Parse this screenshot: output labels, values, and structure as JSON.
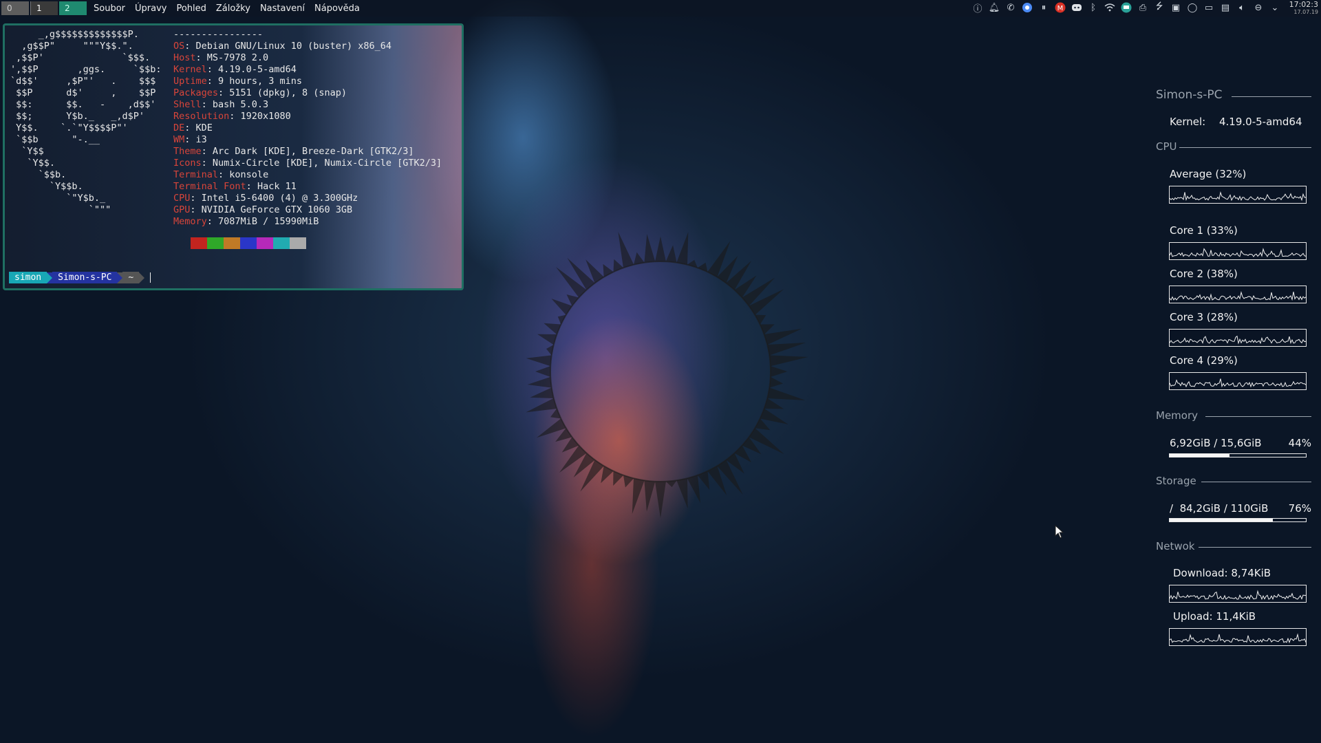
{
  "topbar": {
    "workspaces": [
      "0",
      "1",
      "2"
    ],
    "menus": [
      "Soubor",
      "Úpravy",
      "Pohled",
      "Záložky",
      "Nastavení",
      "Nápověda"
    ],
    "tray_icons": [
      "info-icon",
      "bell-icon",
      "whatsapp-icon",
      "chrome-icon",
      "pause-icon",
      "gmail-icon",
      "discord-icon",
      "bluetooth-icon",
      "wifi-icon",
      "monitor-icon",
      "printer-icon",
      "usb-icon",
      "clipboard-icon",
      "bulb-icon",
      "display-icon",
      "disk-icon",
      "volume-icon",
      "update-icon",
      "chevron-down-icon"
    ],
    "clock_time": "17:02:3",
    "clock_date": "17.07.19"
  },
  "terminal": {
    "ascii_lines": [
      "     _,g$$$$$$$$$$$$$P.",
      "  ,g$$P\"     \"\"\"Y$$.\".",
      " ,$$P'              `$$$.",
      "',$$P       ,ggs.     `$$b:",
      "`d$$'     ,$P\"'   .    $$$",
      " $$P      d$'     ,    $$P",
      " $$:      $$.   -    ,d$$'",
      " $$;      Y$b._   _,d$P'",
      " Y$$.    `.`\"Y$$$$P\"'",
      " `$$b      \"-.__",
      "  `Y$$",
      "   `Y$$.",
      "     `$$b.",
      "       `Y$$b.",
      "          `\"Y$b._",
      "              `\"\"\""
    ],
    "separator": "----------------",
    "info": [
      {
        "key": "OS",
        "value": "Debian GNU/Linux 10 (buster) x86_64"
      },
      {
        "key": "Host",
        "value": "MS-7978 2.0"
      },
      {
        "key": "Kernel",
        "value": "4.19.0-5-amd64"
      },
      {
        "key": "Uptime",
        "value": "9 hours, 3 mins"
      },
      {
        "key": "Packages",
        "value": "5151 (dpkg), 8 (snap)"
      },
      {
        "key": "Shell",
        "value": "bash 5.0.3"
      },
      {
        "key": "Resolution",
        "value": "1920x1080"
      },
      {
        "key": "DE",
        "value": "KDE"
      },
      {
        "key": "WM",
        "value": "i3"
      },
      {
        "key": "Theme",
        "value": "Arc Dark [KDE], Breeze-Dark [GTK2/3]"
      },
      {
        "key": "Icons",
        "value": "Numix-Circle [KDE], Numix-Circle [GTK2/3]"
      },
      {
        "key": "Terminal",
        "value": "konsole"
      },
      {
        "key": "Terminal Font",
        "value": "Hack 11"
      },
      {
        "key": "CPU",
        "value": "Intel i5-6400 (4) @ 3.300GHz"
      },
      {
        "key": "GPU",
        "value": "NVIDIA GeForce GTX 1060 3GB"
      },
      {
        "key": "Memory",
        "value": "7087MiB / 15990MiB"
      }
    ],
    "swatch_colors": [
      "#c2241f",
      "#2fa829",
      "#c07a26",
      "#2a36c8",
      "#b629b9",
      "#21abb1",
      "#aaaaaa"
    ],
    "prompt": {
      "user": "simon",
      "host": "Simon-s-PC",
      "dir": "~"
    },
    "colors": {
      "user_bg": "#18a7b5",
      "host_bg": "#2433a0",
      "dir_bg": "#555555",
      "key": "#d9453a"
    }
  },
  "conky": {
    "hostname": "Simon-s-PC",
    "kernel_label": "Kernel:",
    "kernel_value": "4.19.0-5-amd64",
    "cpu_title": "CPU",
    "cpu": [
      {
        "label": "Average (32%)",
        "value": 32
      },
      {
        "label": "Core 1 (33%)",
        "value": 33
      },
      {
        "label": "Core 2 (38%)",
        "value": 38
      },
      {
        "label": "Core 3 (28%)",
        "value": 28
      },
      {
        "label": "Core 4 (29%)",
        "value": 29
      }
    ],
    "memory_title": "Memory",
    "memory_text": "6,92GiB / 15,6GiB",
    "memory_pct": "44%",
    "memory_fraction": 0.44,
    "storage_title": "Storage",
    "storage_text": "/  84,2GiB / 110GiB",
    "storage_pct": "76%",
    "storage_fraction": 0.76,
    "network_title": "Netwok",
    "download_label": "Download: 8,74KiB",
    "upload_label": "Upload: 11,4KiB"
  }
}
